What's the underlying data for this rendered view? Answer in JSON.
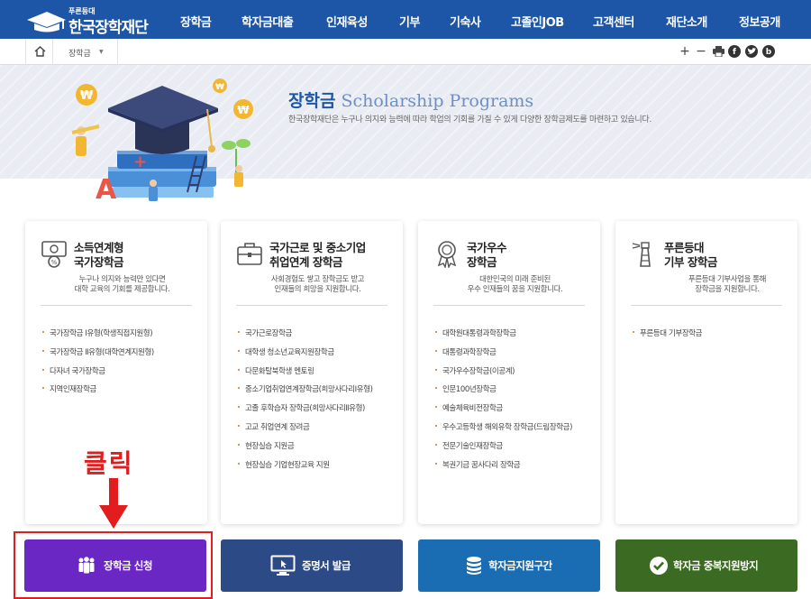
{
  "logo": {
    "small": "푸른등대",
    "name": "한국장학재단"
  },
  "nav": {
    "items": [
      "장학금",
      "학자금대출",
      "인재육성",
      "기부",
      "기숙사",
      "고졸인JOB",
      "고객센터",
      "재단소개",
      "정보공개"
    ]
  },
  "breadcrumb": {
    "current": "장학금"
  },
  "toolbar": {
    "zoom_in": "+",
    "zoom_out": "−",
    "facebook": "f",
    "blog": "b"
  },
  "banner": {
    "title_ko": "장학금",
    "title_en": "Scholarship Programs",
    "description": "한국장학재단은 누구나 의지와 능력에 따라 학업의 기회를 가질 수 있게 다양한 장학금제도를 마련하고 있습니다."
  },
  "cards": [
    {
      "title_line1": "소득연계형",
      "title_line2": "국가장학금",
      "desc_line1": "누구나 의지와 능력만 있다면",
      "desc_line2": "대학 교육의 기회를 제공합니다.",
      "items": [
        "국가장학금 Ⅰ유형(학생직접지원형)",
        "국가장학금 Ⅱ유형(대학연계지원형)",
        "다자녀 국가장학금",
        "지역인재장학금"
      ]
    },
    {
      "title_line1": "국가근로 및 중소기업",
      "title_line2": "취업연계 장학금",
      "desc_line1": "사회경험도 쌓고 장학금도 받고",
      "desc_line2": "인재들의 희망을 지원합니다.",
      "items": [
        "국가근로장학금",
        "대학생 청소년교육지원장학금",
        "다문화탈북학생 멘토링",
        "중소기업취업연계장학금(희망사다리Ⅰ유형)",
        "고졸 후학습자 장학금(희망사다리Ⅱ유형)",
        "고교 취업연계 장려금",
        "현장실습 지원금",
        "현장실습 기업현장교육 지원"
      ]
    },
    {
      "title_line1": "국가우수",
      "title_line2": "장학금",
      "desc_line1": "대한민국의 미래 준비된",
      "desc_line2": "우수 인재들의 꿈을 지원합니다.",
      "items": [
        "대학원대통령과학장학금",
        "대통령과학장학금",
        "국가우수장학금(이공계)",
        "인문100년장학금",
        "예술체육비전장학금",
        "우수고등학생 해외유학 장학금(드림장학금)",
        "전문기술인재장학금",
        "복권기금 꿈사다리 장학금"
      ]
    },
    {
      "title_line1": "푸른등대",
      "title_line2": "기부 장학금",
      "desc_line1": "푸른등대 기부사업을 통해",
      "desc_line2": "장학금을 지원합니다.",
      "items": [
        "푸른등대 기부장학금"
      ]
    }
  ],
  "actions": [
    {
      "label": "장학금 신청",
      "color": "#6a27c4"
    },
    {
      "label": "증명서 발급",
      "color": "#2c4a86"
    },
    {
      "label": "학자금지원구간",
      "color": "#1b6db3"
    },
    {
      "label": "학자금 중복지원방지",
      "color": "#3b6a22"
    }
  ],
  "annotation": {
    "text": "클릭",
    "color": "#e11d1d"
  }
}
